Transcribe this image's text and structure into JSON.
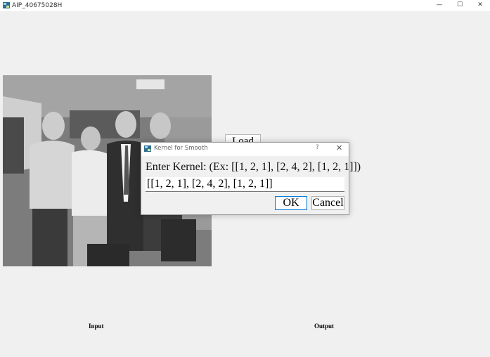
{
  "window": {
    "title": "AIP_40675028H",
    "minimize": "—",
    "maximize": "☐",
    "close": "✕"
  },
  "main": {
    "load_label": "Load",
    "input_label": "Input",
    "output_label": "Output"
  },
  "dialog": {
    "title": "Kernel for Smooth",
    "help": "?",
    "close": "✕",
    "prompt": "Enter Kernel: (Ex: [[1, 2, 1], [2, 4, 2], [1, 2, 1]])",
    "value": "[[1, 2, 1], [2, 4, 2], [1, 2, 1]]",
    "ok_label": "OK",
    "cancel_label": "Cancel"
  },
  "icons": {
    "app": "app-icon",
    "dialog": "dialog-app-icon"
  }
}
